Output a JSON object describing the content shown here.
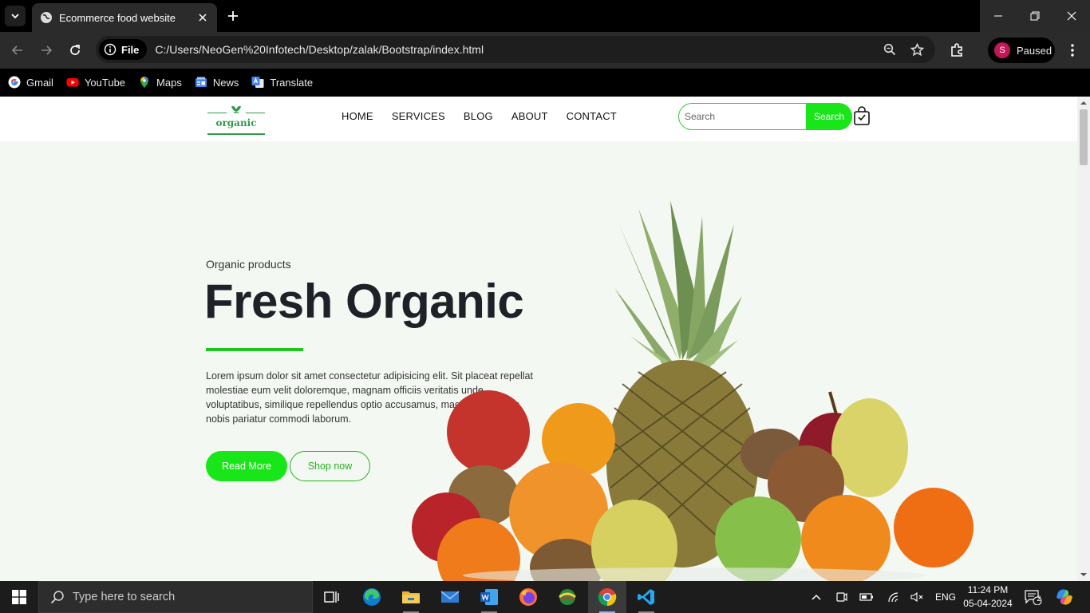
{
  "browser": {
    "tab_title": "Ecommerce food website",
    "url_scheme_label": "File",
    "url": "C:/Users/NeoGen%20Infotech/Desktop/zalak/Bootstrap/index.html",
    "profile_initial": "S",
    "profile_label": "Paused",
    "bookmarks": [
      {
        "label": "Gmail",
        "icon": "gmail-icon"
      },
      {
        "label": "YouTube",
        "icon": "youtube-icon"
      },
      {
        "label": "Maps",
        "icon": "maps-icon"
      },
      {
        "label": "News",
        "icon": "news-icon"
      },
      {
        "label": "Translate",
        "icon": "translate-icon"
      }
    ]
  },
  "site": {
    "logo_text": "organic",
    "nav": [
      "HOME",
      "SERVICES",
      "BLOG",
      "ABOUT",
      "CONTACT"
    ],
    "search_placeholder": "Search",
    "search_button": "Search",
    "hero": {
      "subtitle": "Organic products",
      "title": "Fresh Organic",
      "text": "Lorem ipsum dolor sit amet consectetur adipisicing elit. Sit placeat repellat molestiae eum velit doloremque, magnam officiis veritatis unde voluptatibus, similique repellendus optio accusamus, magni laudantium nobis pariatur commodi laborum.",
      "primary_button": "Read More",
      "secondary_button": "Shop now"
    },
    "colors": {
      "accent": "#19e619",
      "heading": "#1e2228",
      "logo": "#2e9b4a"
    }
  },
  "taskbar": {
    "search_placeholder": "Type here to search",
    "language": "ENG",
    "time": "11:24 PM",
    "date": "05-04-2024",
    "notification_count": "2"
  }
}
